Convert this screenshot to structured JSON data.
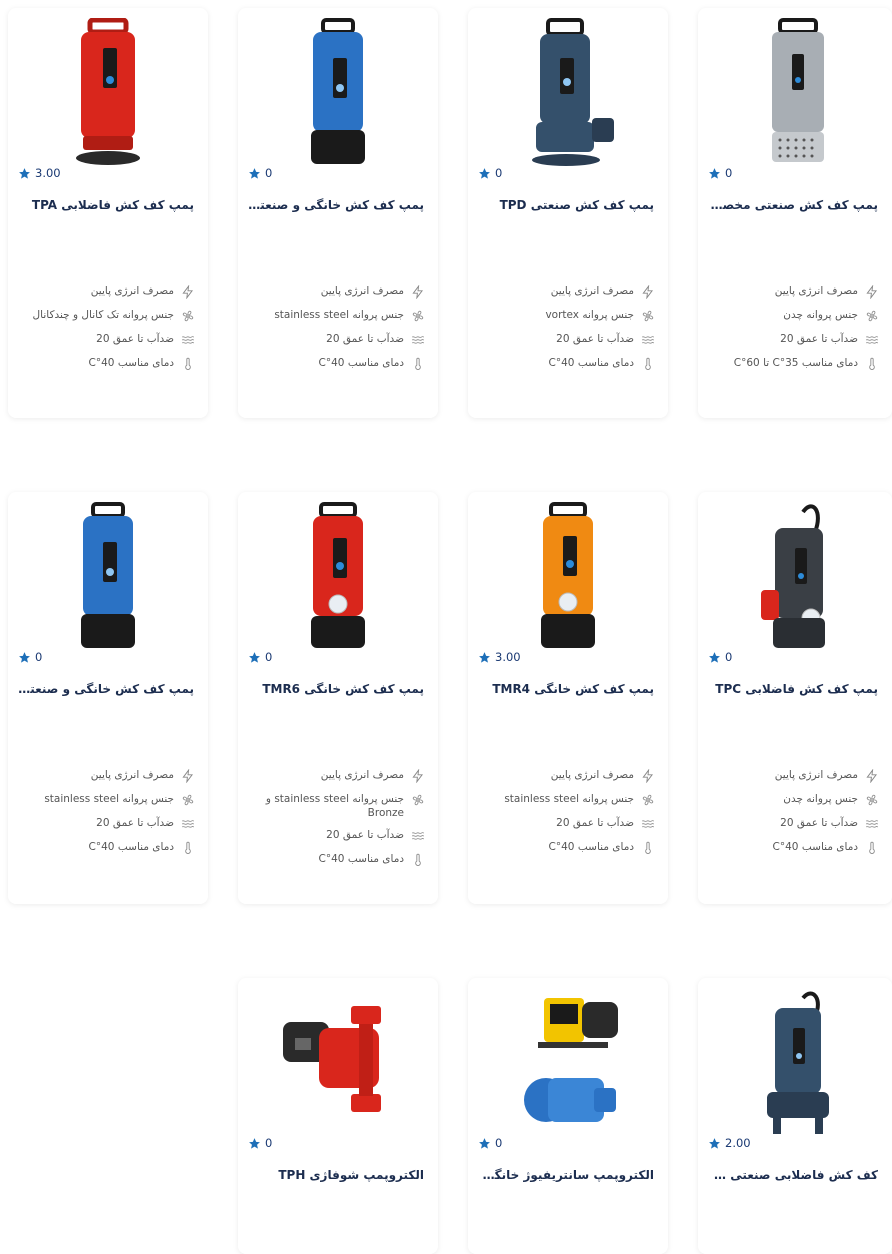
{
  "colors": {
    "accent": "#1d6fb8",
    "title": "#1c2d4f",
    "spec_text": "#555555"
  },
  "spec_icons": [
    "lightning-icon",
    "fan-icon",
    "waves-icon",
    "thermometer-icon"
  ],
  "cards": [
    {
      "title": "پمپ کف کش فاضلابی TPA",
      "rating": "3.00",
      "pump_color": "#d9261c",
      "specs": [
        "مصرف انرژی پایین",
        "جنس پروانه تک کانال و چندکانال",
        "ضدآب تا عمق 20",
        "دمای مناسب 40°C"
      ]
    },
    {
      "title": "پمپ کف کش خانگی و صنعتی...",
      "rating": "0",
      "pump_color": "#2b72c4",
      "specs": [
        "مصرف انرژی پایین",
        "جنس پروانه stainless steel",
        "ضدآب تا عمق 20",
        "دمای مناسب 40°C"
      ]
    },
    {
      "title": "پمپ کف کش صنعتی TPD",
      "rating": "0",
      "pump_color": "#34506b",
      "specs": [
        "مصرف انرژی پایین",
        "جنس پروانه vortex",
        "ضدآب تا عمق 20",
        "دمای مناسب 40°C"
      ]
    },
    {
      "title": "پمپ کف کش صنعتی مخصوص...",
      "rating": "0",
      "pump_color": "#9aa0a6",
      "specs": [
        "مصرف انرژی پایین",
        "جنس پروانه چدن",
        "ضدآب تا عمق 20",
        "دمای مناسب 35°C تا 60°C"
      ]
    },
    {
      "title": "پمپ کف کش خانگی و صنعتی...",
      "rating": "0",
      "pump_color": "#2b72c4",
      "specs": [
        "مصرف انرژی پایین",
        "جنس پروانه stainless steel",
        "ضدآب تا عمق 20",
        "دمای مناسب 40°C"
      ]
    },
    {
      "title": "پمپ کف کش خانگی TMR6",
      "rating": "0",
      "pump_color": "#d9261c",
      "specs": [
        "مصرف انرژی پایین",
        "جنس پروانه stainless steel و Bronze",
        "ضدآب تا عمق 20",
        "دمای مناسب 40°C"
      ]
    },
    {
      "title": "پمپ کف کش خانگی TMR4",
      "rating": "3.00",
      "pump_color": "#f08a12",
      "specs": [
        "مصرف انرژی پایین",
        "جنس پروانه stainless steel",
        "ضدآب تا عمق 20",
        "دمای مناسب 40°C"
      ]
    },
    {
      "title": "پمپ کف کش فاضلابی TPC",
      "rating": "0",
      "pump_color": "#3a3f45",
      "specs": [
        "مصرف انرژی پایین",
        "جنس پروانه چدن",
        "ضدآب تا عمق 20",
        "دمای مناسب 40°C"
      ]
    },
    {
      "title": "الکتروپمپ شوفاژی TPH",
      "rating": "0",
      "pump_color": "#d9261c",
      "specs": []
    },
    {
      "title": "الکتروپمپ سانتریفیوژ خانگی TPS",
      "rating": "0",
      "pump_color": "#2b72c4",
      "specs": []
    },
    {
      "title": "کف کش فاضلابی صنعتی TPB",
      "rating": "2.00",
      "pump_color": "#34506b",
      "specs": []
    }
  ]
}
